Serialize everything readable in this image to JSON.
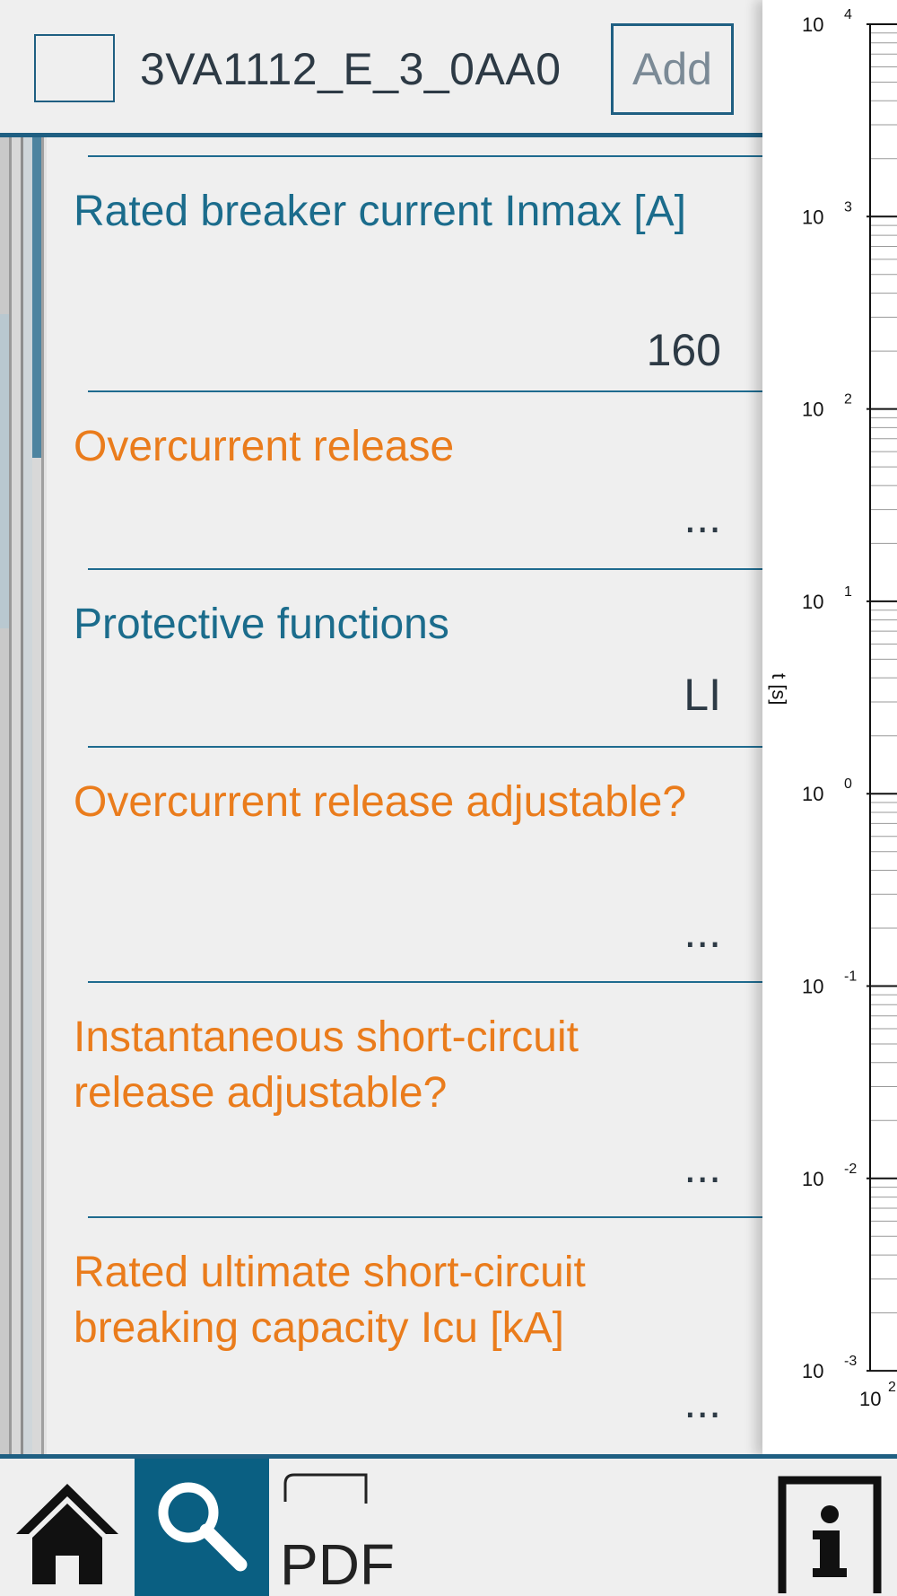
{
  "header": {
    "product_code": "3VA1112_E_3_0AA0",
    "add_label": "Add"
  },
  "properties": [
    {
      "label": "Rated breaker current Inmax [A]",
      "value": "160",
      "style": "blue"
    },
    {
      "label": "Overcurrent release",
      "value": "...",
      "style": "orange"
    },
    {
      "label": "Protective functions",
      "value": "LI",
      "style": "blue"
    },
    {
      "label": "Overcurrent release adjustable?",
      "value": "...",
      "style": "orange"
    },
    {
      "label": "Instantaneous short-circuit release adjustable?",
      "value": "...",
      "style": "orange"
    },
    {
      "label": "Rated ultimate short-circuit breaking capacity Icu [kA]",
      "value": "...",
      "style": "orange"
    }
  ],
  "chart_data": {
    "type": "line",
    "title": "",
    "xlabel": "",
    "ylabel": "t [s]",
    "y_scale": "log",
    "ylim": [
      0.001,
      10000
    ],
    "y_ticks": [
      {
        "base": "10",
        "exp": "4"
      },
      {
        "base": "10",
        "exp": "3"
      },
      {
        "base": "10",
        "exp": "2"
      },
      {
        "base": "10",
        "exp": "1"
      },
      {
        "base": "10",
        "exp": "0"
      },
      {
        "base": "10",
        "exp": "-1"
      },
      {
        "base": "10",
        "exp": "-2"
      },
      {
        "base": "10",
        "exp": "-3"
      }
    ],
    "x_ticks": [
      {
        "base": "10",
        "exp": "2"
      }
    ],
    "grid": true,
    "series": []
  },
  "toolbar": {
    "pdf_label": "PDF",
    "icons": [
      "home-icon",
      "search-icon",
      "pdf-icon",
      "info-icon"
    ]
  },
  "colors": {
    "accent": "#1f5f82",
    "active_tab": "#0a5f82",
    "label_blue": "#1b6c8c",
    "label_orange": "#ea7c1c"
  }
}
